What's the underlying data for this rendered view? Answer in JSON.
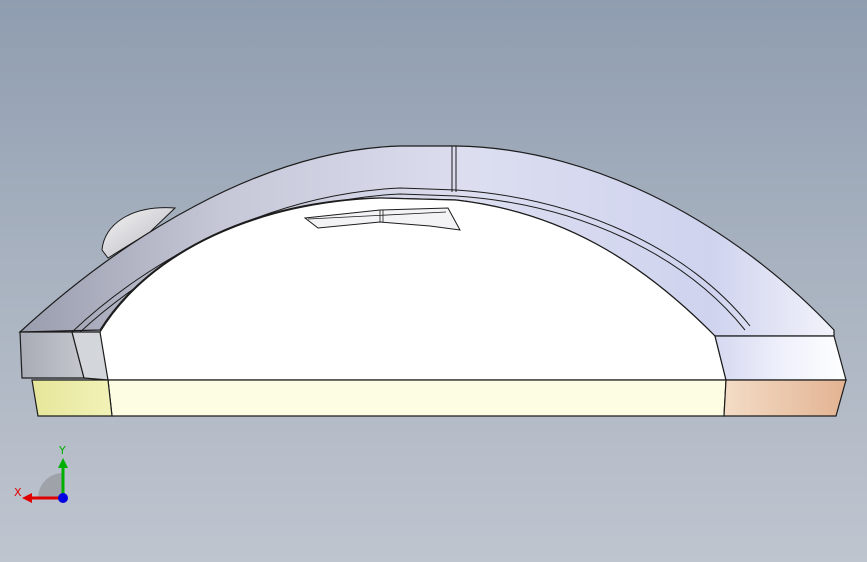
{
  "viewport": {
    "background_top": "#8f9db0",
    "background_bottom": "#bfc5cf"
  },
  "model": {
    "name": "mouse-side-view",
    "body_color": "#ffffff",
    "shell_color": "#c9cde3",
    "base_color": "#fdfde3",
    "base_left_color": "#ecec9e",
    "base_right_color": "#e9c0a0",
    "outline_color": "#1c1c1c"
  },
  "triad": {
    "x_label": "X",
    "y_label": "Y",
    "x_color": "#e00000",
    "y_color": "#00b000",
    "z_color": "#0000e0"
  }
}
